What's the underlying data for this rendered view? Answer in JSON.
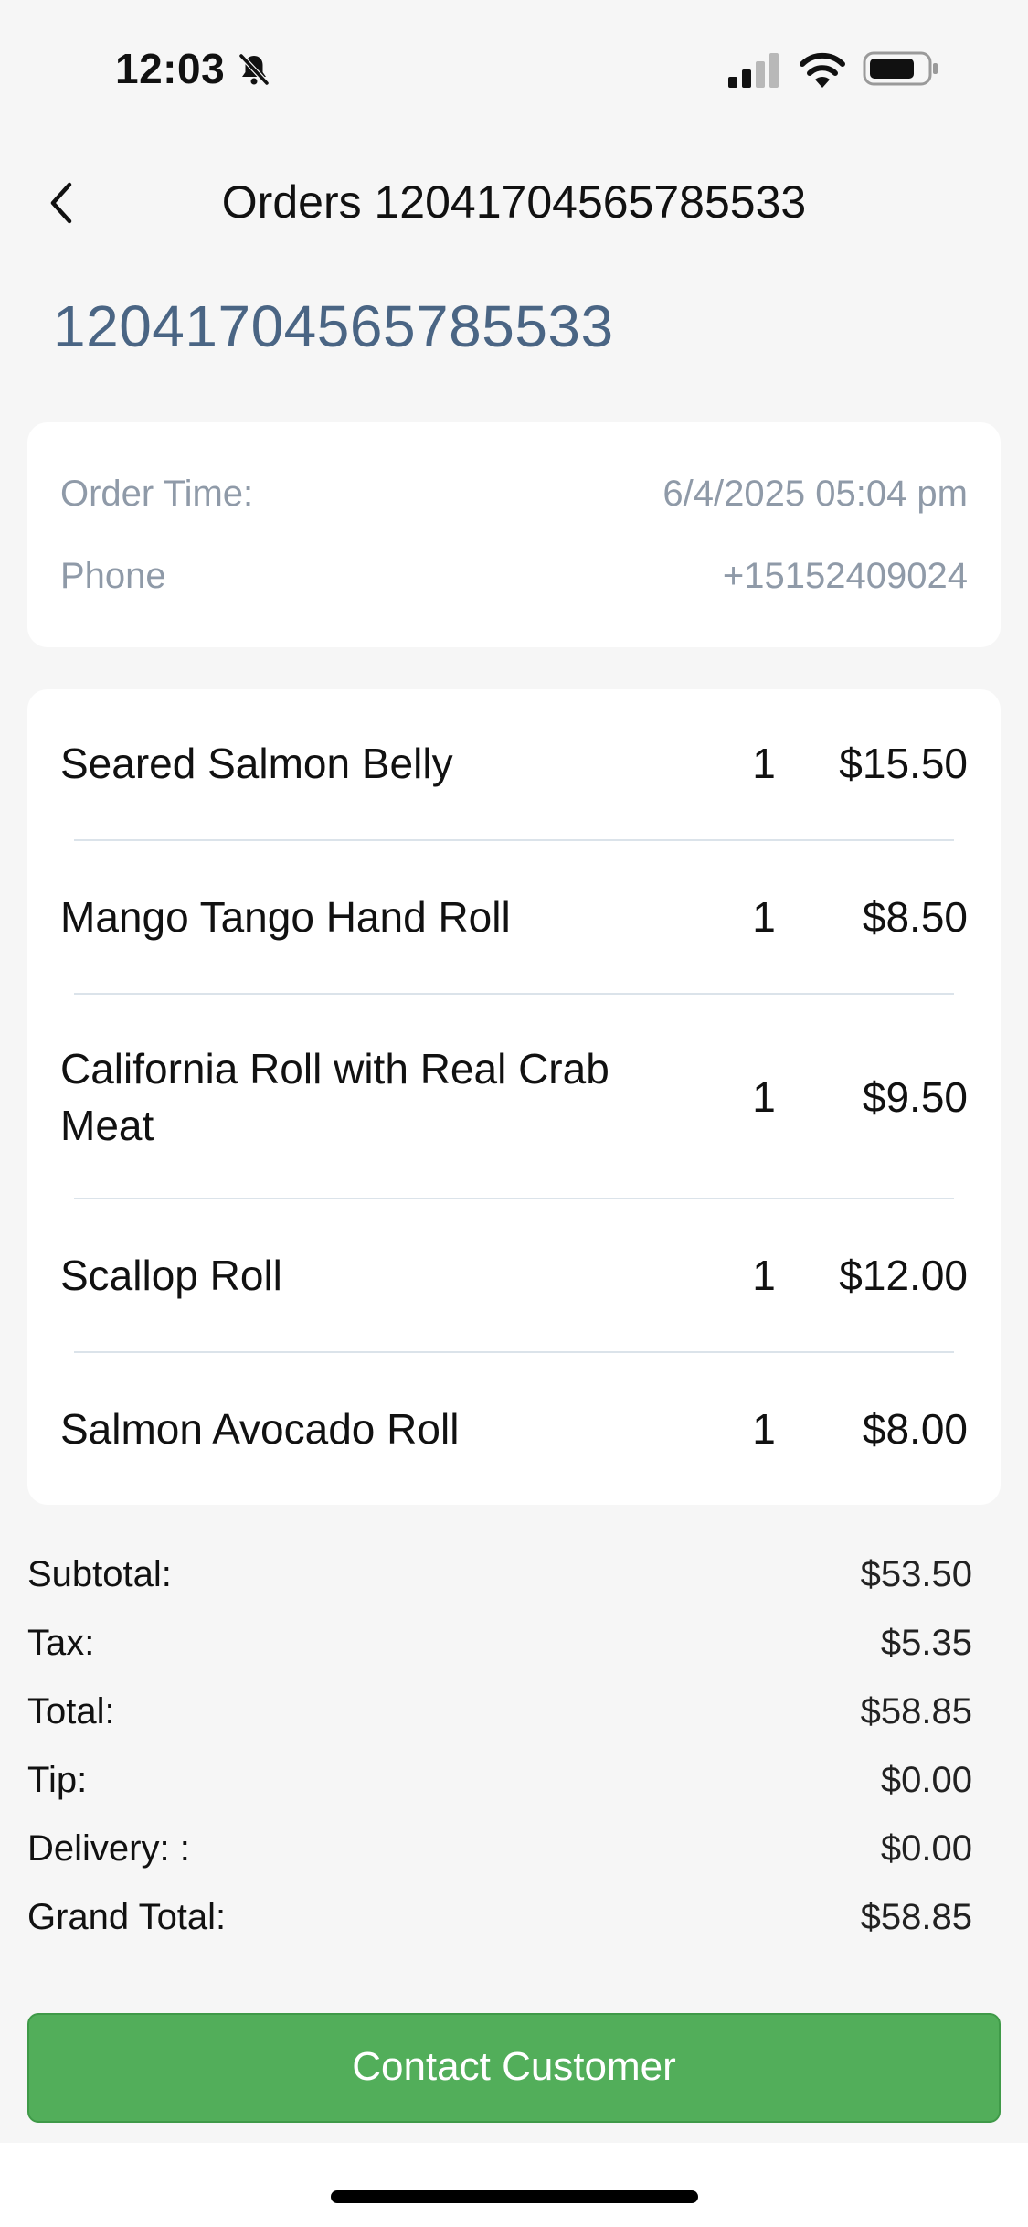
{
  "status_bar": {
    "time": "12:03",
    "icons": [
      "bell-slash-icon",
      "cellular-signal-icon",
      "wifi-icon",
      "battery-icon"
    ]
  },
  "nav": {
    "back_icon": "chevron-left-icon",
    "title": "Orders 12041704565785533"
  },
  "order": {
    "number": "12041704565785533",
    "info": [
      {
        "label": "Order Time:",
        "value": "6/4/2025 05:04 pm"
      },
      {
        "label": "Phone",
        "value": "+15152409024"
      }
    ]
  },
  "items": [
    {
      "name": "Seared Salmon Belly",
      "qty": "1",
      "price": "$15.50"
    },
    {
      "name": "Mango Tango Hand Roll",
      "qty": "1",
      "price": "$8.50"
    },
    {
      "name": "California Roll with Real Crab Meat",
      "qty": "1",
      "price": "$9.50"
    },
    {
      "name": "Scallop Roll",
      "qty": "1",
      "price": "$12.00"
    },
    {
      "name": "Salmon Avocado Roll",
      "qty": "1",
      "price": "$8.00"
    }
  ],
  "totals": [
    {
      "label": "Subtotal:",
      "value": "$53.50"
    },
    {
      "label": "Tax:",
      "value": "$5.35"
    },
    {
      "label": "Total:",
      "value": "$58.85"
    },
    {
      "label": "Tip:",
      "value": "$0.00"
    },
    {
      "label": "Delivery: :",
      "value": "$0.00"
    },
    {
      "label": "Grand Total:",
      "value": "$58.85"
    }
  ],
  "contact_button_label": "Contact Customer",
  "colors": {
    "background": "#f6f6f6",
    "accent_green": "#52ae5a",
    "order_number_blue": "#4a6584",
    "muted_text": "#8f9aa8"
  }
}
